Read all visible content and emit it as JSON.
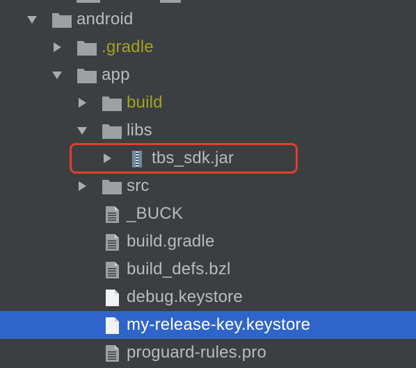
{
  "colors": {
    "background": "#3c3f41",
    "selection": "#2f65ca",
    "folder_icon": "#9ea1a3",
    "excluded_text": "#a3a31f",
    "default_text": "#bbbbbb",
    "highlight_box": "#e0412b"
  },
  "tree": [
    {
      "label": "android",
      "type": "folder",
      "arrow": "expanded",
      "depth": 0,
      "excluded": false
    },
    {
      "label": ".gradle",
      "type": "folder",
      "arrow": "collapsed",
      "depth": 1,
      "excluded": true
    },
    {
      "label": "app",
      "type": "folder",
      "arrow": "expanded",
      "depth": 1,
      "excluded": false
    },
    {
      "label": "build",
      "type": "folder",
      "arrow": "collapsed",
      "depth": 2,
      "excluded": true
    },
    {
      "label": "libs",
      "type": "folder",
      "arrow": "expanded",
      "depth": 2,
      "excluded": false
    },
    {
      "label": "tbs_sdk.jar",
      "type": "jar",
      "arrow": "collapsed",
      "depth": 3,
      "excluded": false,
      "highlighted": true
    },
    {
      "label": "src",
      "type": "folder",
      "arrow": "collapsed",
      "depth": 2,
      "excluded": false
    },
    {
      "label": "_BUCK",
      "type": "text-file",
      "arrow": "none",
      "depth": 2,
      "excluded": false
    },
    {
      "label": "build.gradle",
      "type": "text-file",
      "arrow": "none",
      "depth": 2,
      "excluded": false
    },
    {
      "label": "build_defs.bzl",
      "type": "text-file",
      "arrow": "none",
      "depth": 2,
      "excluded": false
    },
    {
      "label": "debug.keystore",
      "type": "plain-file",
      "arrow": "none",
      "depth": 2,
      "excluded": false
    },
    {
      "label": "my-release-key.keystore",
      "type": "plain-file",
      "arrow": "none",
      "depth": 2,
      "excluded": false,
      "selected": true
    },
    {
      "label": "proguard-rules.pro",
      "type": "text-file",
      "arrow": "none",
      "depth": 2,
      "excluded": false
    }
  ]
}
